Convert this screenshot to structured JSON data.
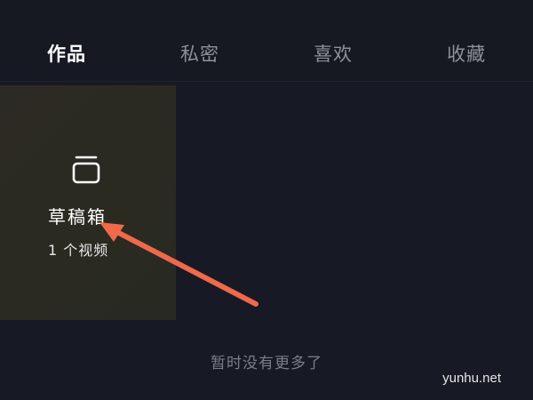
{
  "tabs": [
    {
      "label": "作品",
      "active": true
    },
    {
      "label": "私密",
      "active": false
    },
    {
      "label": "喜欢",
      "active": false
    },
    {
      "label": "收藏",
      "active": false
    }
  ],
  "draft_box": {
    "title": "草稿箱",
    "count_text": "1 个视频",
    "icon": "draft-box-icon"
  },
  "empty_hint": "暂时没有更多了",
  "watermark": "yunhu.net",
  "colors": {
    "background": "#171a24",
    "active_tab_underline": "#f5c518",
    "arrow": "#f0694a",
    "inactive_tab_text": "#8f919a"
  }
}
